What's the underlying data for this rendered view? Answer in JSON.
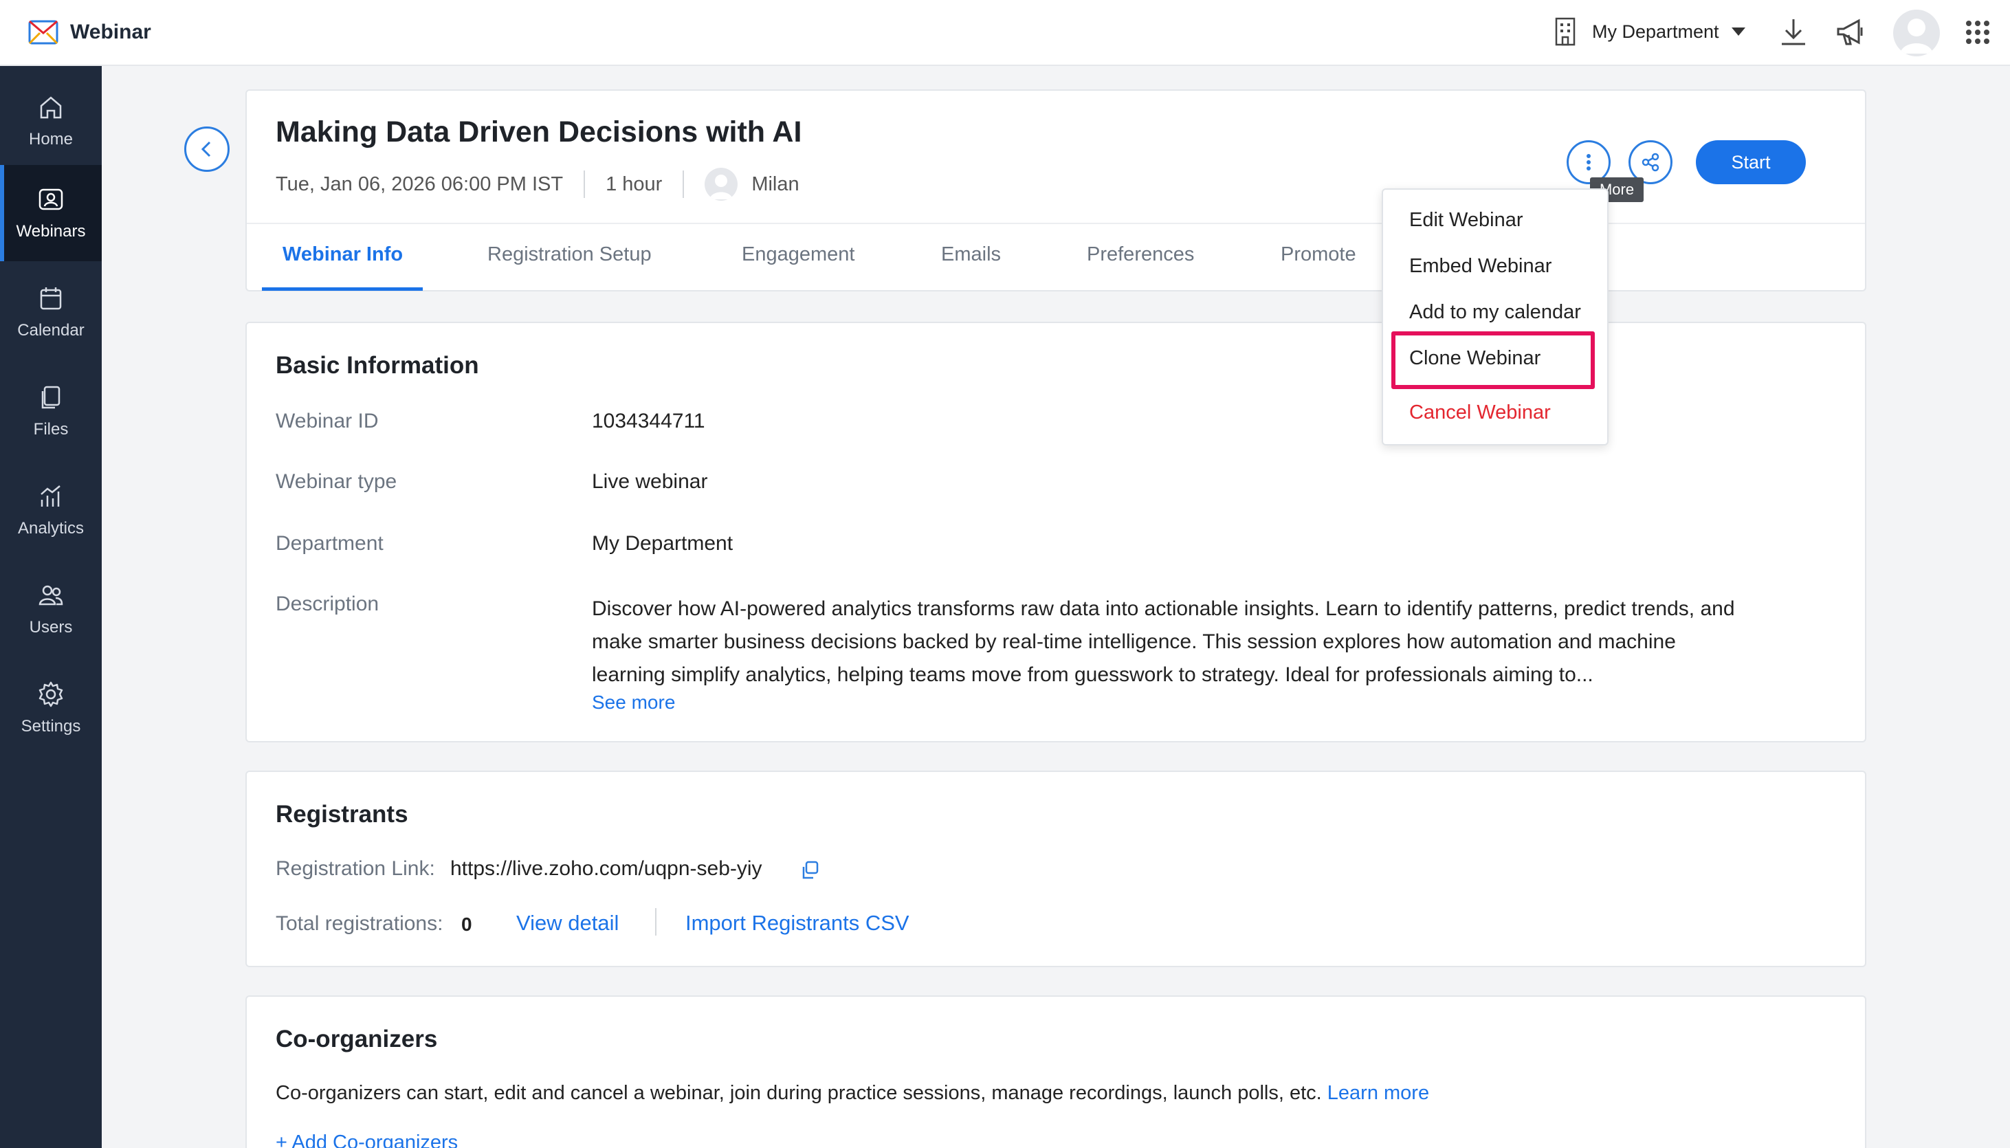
{
  "app": {
    "name": "Webinar"
  },
  "header": {
    "department": "My Department",
    "icons": [
      "building-icon",
      "download-icon",
      "megaphone-icon",
      "avatar",
      "apps-grid-icon"
    ]
  },
  "sidebar": {
    "items": [
      {
        "label": "Home",
        "icon": "home-icon"
      },
      {
        "label": "Webinars",
        "icon": "webinar-icon",
        "active": true
      },
      {
        "label": "Calendar",
        "icon": "calendar-icon"
      },
      {
        "label": "Files",
        "icon": "files-icon"
      },
      {
        "label": "Analytics",
        "icon": "analytics-icon"
      },
      {
        "label": "Users",
        "icon": "users-icon"
      },
      {
        "label": "Settings",
        "icon": "gear-icon"
      }
    ]
  },
  "webinar": {
    "title": "Making Data Driven Decisions with AI",
    "datetime": "Tue, Jan 06, 2026 06:00 PM IST",
    "duration": "1 hour",
    "host": "Milan",
    "start_label": "Start",
    "more_tooltip": "More"
  },
  "tabs": [
    {
      "label": "Webinar Info",
      "active": true
    },
    {
      "label": "Registration Setup"
    },
    {
      "label": "Engagement"
    },
    {
      "label": "Emails"
    },
    {
      "label": "Preferences"
    },
    {
      "label": "Promote"
    }
  ],
  "more_menu": {
    "items": [
      "Edit Webinar",
      "Embed Webinar",
      "Add to my calendar",
      "Clone Webinar",
      "Cancel Webinar"
    ],
    "highlighted": "Clone Webinar",
    "danger": "Cancel Webinar"
  },
  "basic_info": {
    "title": "Basic Information",
    "rows": [
      {
        "label": "Webinar ID",
        "value": "1034344711"
      },
      {
        "label": "Webinar type",
        "value": "Live webinar"
      },
      {
        "label": "Department",
        "value": "My Department"
      }
    ],
    "description_label": "Description",
    "description": "Discover how AI-powered analytics transforms raw data into actionable insights. Learn to identify patterns, predict trends, and make smarter business decisions backed by real-time intelligence. This session explores how automation and machine learning simplify analytics, helping teams move from guesswork to strategy. Ideal for professionals aiming to...",
    "see_more": "See more"
  },
  "registrants": {
    "title": "Registrants",
    "link_label": "Registration Link:",
    "link": "https://live.zoho.com/uqpn-seb-yiy",
    "total_label": "Total registrations:",
    "total": "0",
    "view_detail": "View detail",
    "import_csv": "Import Registrants CSV"
  },
  "coorganizers": {
    "title": "Co-organizers",
    "text": "Co-organizers can start, edit and cancel a webinar, join during practice sessions, manage recordings, launch polls, etc.",
    "learn_more": "Learn more",
    "add": "+ Add Co-organizers"
  }
}
